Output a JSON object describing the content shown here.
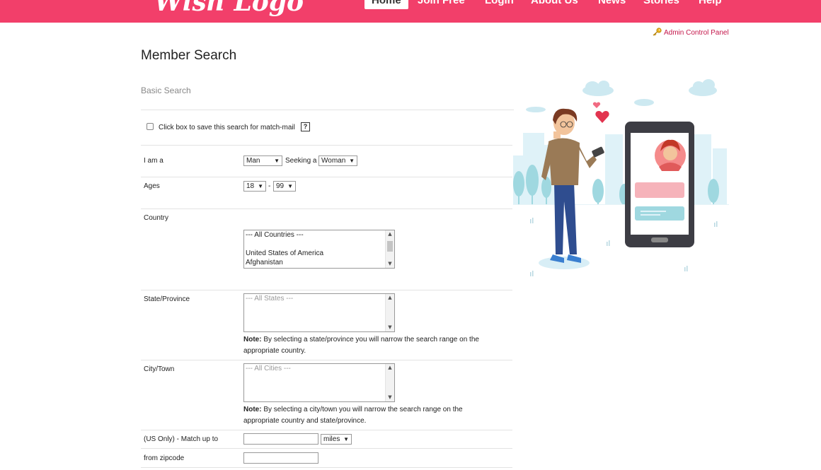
{
  "header": {
    "logo_text": "Wish Logo",
    "nav": [
      "Home",
      "Join Free",
      "Login",
      "About Us",
      "News",
      "Stories",
      "Help"
    ],
    "active_nav": "Home"
  },
  "admin_link": "Admin Control Panel",
  "page_title": "Member Search",
  "section_title": "Basic Search",
  "save_search_label": "Click box to save this search for match-mail",
  "help_icon_glyph": "?",
  "fields": {
    "i_am_label": "I am a",
    "i_am_value": "Man",
    "seeking_label": "Seeking a",
    "seeking_value": "Woman",
    "ages_label": "Ages",
    "age_min": "18",
    "age_separator": "-",
    "age_max": "99",
    "country_label": "Country",
    "country_options": [
      "--- All Countries ---",
      "",
      "United States of America",
      "Afghanistan"
    ],
    "state_label": "State/Province",
    "state_placeholder": "--- All States ---",
    "state_note_bold": "Note:",
    "state_note": "By selecting a state/province you will narrow the search range on the appropriate country.",
    "city_label": "City/Town",
    "city_placeholder": "--- All Cities ---",
    "city_note_bold": "Note:",
    "city_note": "By selecting a city/town you will narrow the search range on the appropriate country and state/province.",
    "match_label": "(US Only) - Match up to",
    "distance_unit": "miles",
    "zipcode_label": "from zipcode"
  },
  "colors": {
    "brand": "#f23f6a",
    "link": "#c4164a"
  }
}
